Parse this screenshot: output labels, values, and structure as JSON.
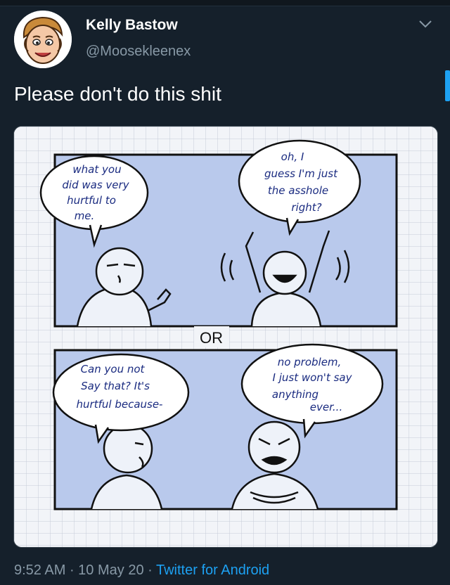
{
  "author": {
    "name": "Kelly Bastow",
    "handle": "@Moosekleenex"
  },
  "tweet": {
    "text": "Please don't do this shit"
  },
  "comic": {
    "panels": [
      {
        "lines": [
          "what you",
          "did was very",
          "hurtful to",
          "me."
        ]
      },
      {
        "lines": [
          "oh, I",
          "guess I'm just",
          "the asshole",
          "right?"
        ]
      },
      {
        "lines": [
          "Can you not",
          "Say that? It's",
          "hurtful because-"
        ]
      },
      {
        "lines": [
          "no problem,",
          "I just won't say",
          "anything",
          "ever..."
        ]
      }
    ],
    "divider": "OR"
  },
  "meta": {
    "time": "9:52 AM",
    "sep1": " · ",
    "date": "10 May 20",
    "sep2": " · ",
    "source": "Twitter for Android"
  },
  "icons": {
    "menu": "chevron-down-icon",
    "avatar": "avatar-image"
  },
  "colors": {
    "background": "#15202b",
    "accent": "#1da1f2",
    "secondary": "#8899a6"
  }
}
